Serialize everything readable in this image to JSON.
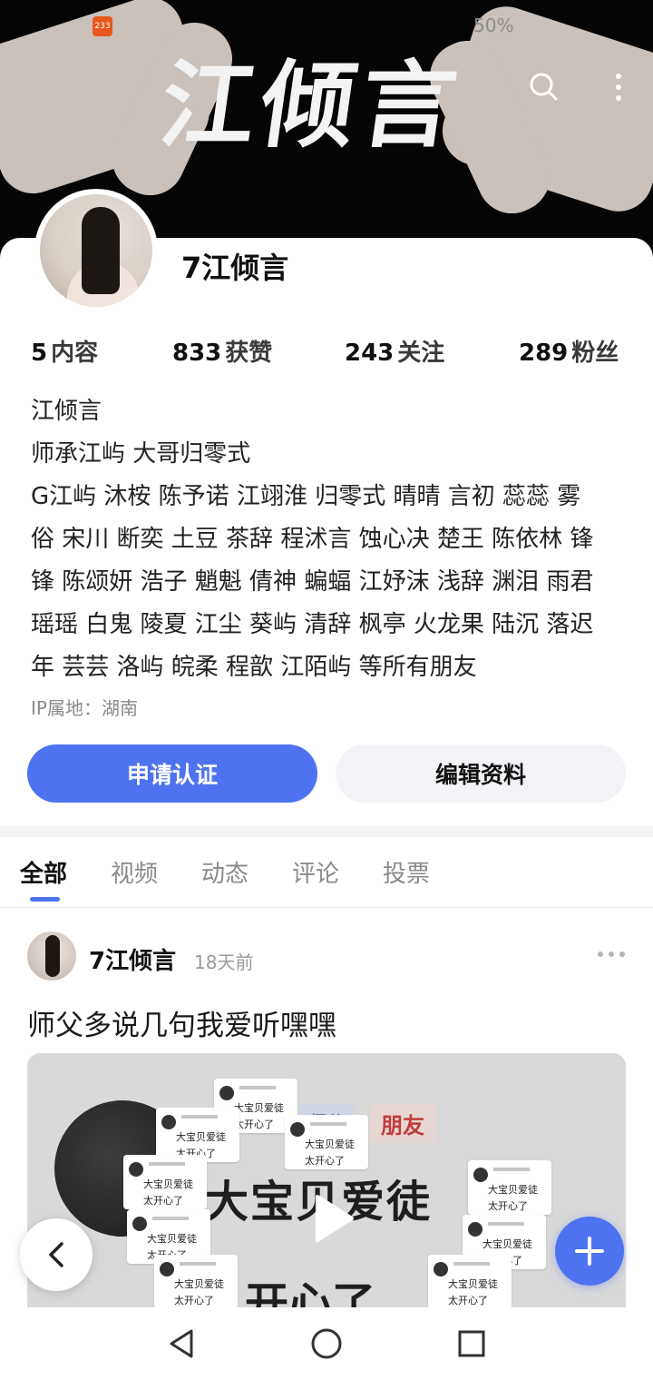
{
  "status_bar": {
    "app_badge": "233",
    "battery": "50%"
  },
  "banner": {
    "title": "江倾言"
  },
  "profile": {
    "username": "7江倾言",
    "stats": [
      {
        "value": "5",
        "label": "内容"
      },
      {
        "value": "833",
        "label": "获赞"
      },
      {
        "value": "243",
        "label": "关注"
      },
      {
        "value": "289",
        "label": "粉丝"
      }
    ],
    "bio_lines": [
      "江倾言",
      "师承江屿 大哥归零式",
      "G江屿 沐桉 陈予诺 江翊淮 归零式 晴晴 言初 蕊蕊 雾",
      "俗 宋川 断奕 土豆 茶辞 程沭言 蚀心决 楚王 陈依林 锋",
      "锋 陈颂妍 浩子 魈魁 倩神 蝙蝠 江妤沫 浅辞 渊泪 雨君",
      "瑶瑶 白鬼 陵夏 江尘 葵屿 清辞 枫亭 火龙果 陆沉 落迟",
      "年 芸芸 洛屿 皖柔 程歆 江陌屿 等所有朋友"
    ],
    "ip_location": "IP属地：湖南",
    "apply_verify_button": "申请认证",
    "edit_profile_button": "编辑资料"
  },
  "tabs": [
    {
      "label": "全部",
      "active": true
    },
    {
      "label": "视频"
    },
    {
      "label": "动态"
    },
    {
      "label": "评论"
    },
    {
      "label": "投票"
    }
  ],
  "post": {
    "author": "7江倾言",
    "time": "18天前",
    "text": "师父多说几句我爱听嘿嘿",
    "video": {
      "big_text_1": "大宝贝爱徒",
      "big_text_2": "开心了",
      "tag": "朋友",
      "tag2": "师父",
      "chip_line_1": "大宝贝爱徒",
      "chip_line_2": "太开心了"
    }
  },
  "colors": {
    "accent": "#4e73f0",
    "banner_bg": "#050505",
    "secondary_button_bg": "#f2f3f6"
  }
}
